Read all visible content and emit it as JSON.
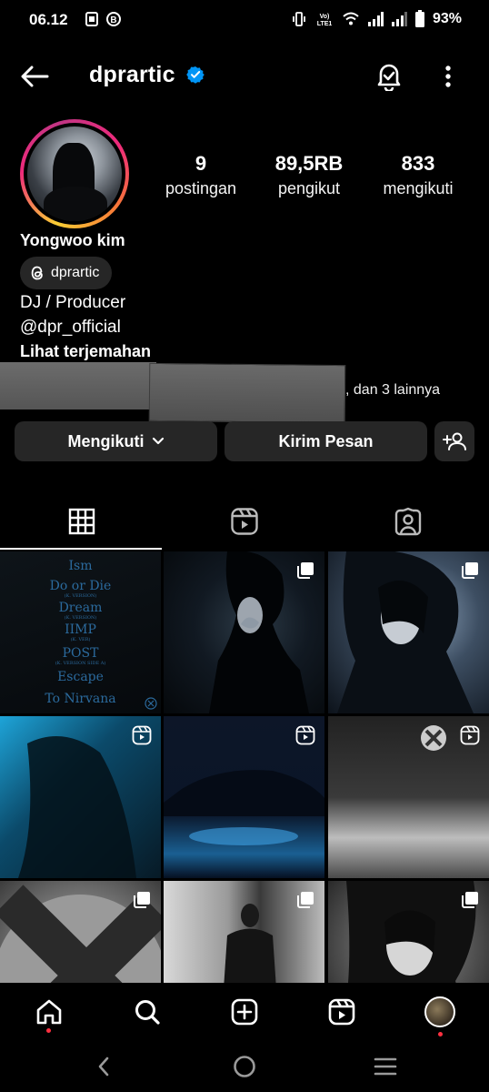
{
  "status_bar": {
    "time": "06.12",
    "battery": "93%",
    "left_icons": [
      "sim-icon",
      "b-icon"
    ],
    "right_icons": [
      "vibrate-icon",
      "volte-icon",
      "wifi-icon",
      "signal-icon",
      "signal2-icon",
      "battery-icon"
    ],
    "volte_label": "VoLTE1"
  },
  "header": {
    "username": "dprartic",
    "verified": true,
    "icons": [
      "back-arrow-icon",
      "notification-bell-icon",
      "more-vertical-icon"
    ]
  },
  "profile": {
    "stats": [
      {
        "value": "9",
        "label": "postingan"
      },
      {
        "value": "89,5RB",
        "label": "pengikut"
      },
      {
        "value": "833",
        "label": "mengikuti"
      }
    ],
    "full_name": "Yongwoo kim",
    "threads_handle": "dprartic",
    "bio_line1": "DJ / Producer",
    "bio_line2": "@dpr_official",
    "translate_link": "Lihat terjemahan",
    "followed_by_suffix": ", dan 3 lainnya"
  },
  "actions": {
    "following_label": "Mengikuti",
    "message_label": "Kirim Pesan"
  },
  "tabs": [
    "grid-icon",
    "reels-icon",
    "tagged-icon"
  ],
  "grid": {
    "tracklist": [
      {
        "title": "Ism",
        "sub": ""
      },
      {
        "title": "Do or Die",
        "sub": "(K. VERSION)"
      },
      {
        "title": "Dream",
        "sub": "(K. VERSION)"
      },
      {
        "title": "IIMP",
        "sub": "(K. VER)"
      },
      {
        "title": "POST",
        "sub": "(K. VERSION SIDE A)"
      },
      {
        "title": "Escape",
        "sub": ""
      },
      {
        "title": "To Nirvana",
        "sub": ""
      }
    ],
    "badges": [
      "",
      "carousel-icon",
      "carousel-icon",
      "reel-icon",
      "reel-icon",
      "reel-icon",
      "carousel-icon",
      "carousel-icon",
      "carousel-icon"
    ]
  },
  "bottom_nav": [
    "home-icon",
    "search-icon",
    "create-icon",
    "reels-icon",
    "profile-avatar"
  ],
  "system_nav": [
    "back-chevron-icon",
    "home-circle-icon",
    "recents-icon"
  ],
  "colors": {
    "background": "#000000",
    "button_bg": "#262626",
    "verified_blue": "#0095f6",
    "notification_red": "#ff3040"
  }
}
